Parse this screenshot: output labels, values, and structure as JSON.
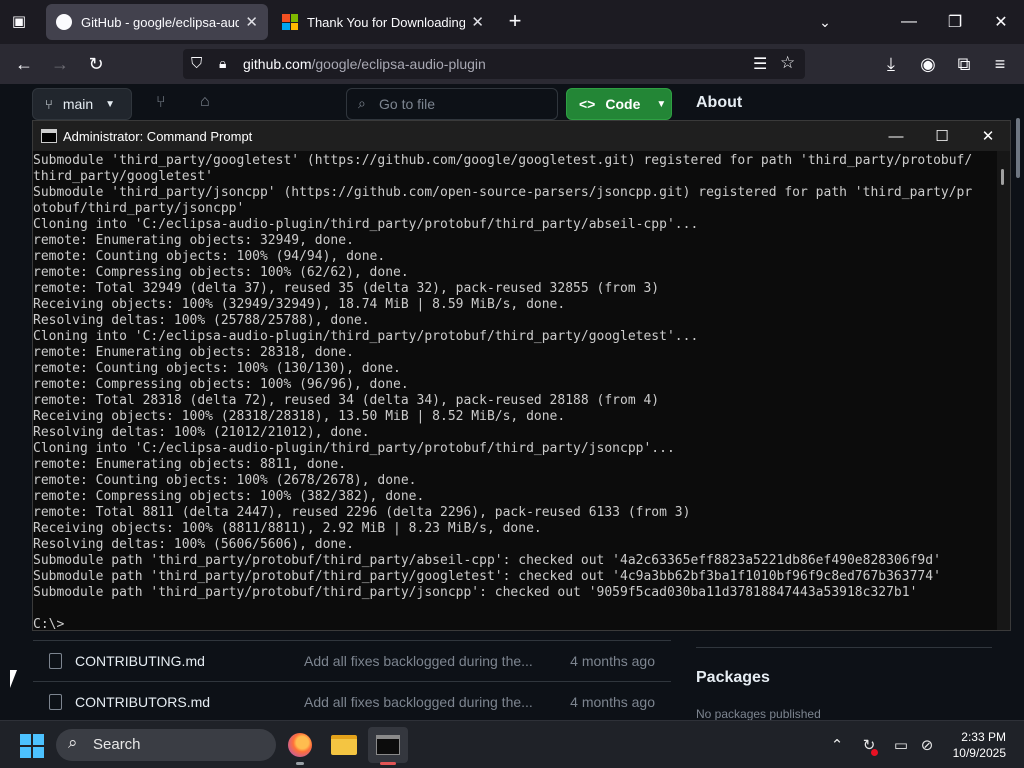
{
  "browser": {
    "tabs": [
      {
        "title": "GitHub - google/eclipsa-audio-",
        "active": true
      },
      {
        "title": "Thank You for Downloading Vis",
        "active": false
      }
    ],
    "new_tab_symbol": "+",
    "url_host": "github.com",
    "url_path": "/google/eclipsa-audio-plugin"
  },
  "github": {
    "branch": "main",
    "go_to_file_placeholder": "Go to file",
    "code_button": "Code",
    "about_heading": "About",
    "files": [
      {
        "name": "CONTRIBUTING.md",
        "message": "Add all fixes backlogged during the...",
        "date": "4 months ago"
      },
      {
        "name": "CONTRIBUTORS.md",
        "message": "Add all fixes backlogged during the...",
        "date": "4 months ago"
      }
    ],
    "packages_heading": "Packages",
    "packages_empty": "No packages published"
  },
  "cmd": {
    "title": "Administrator: Command Prompt",
    "lines": [
      "Submodule 'third_party/googletest' (https://github.com/google/googletest.git) registered for path 'third_party/protobuf/",
      "third_party/googletest'",
      "Submodule 'third_party/jsoncpp' (https://github.com/open-source-parsers/jsoncpp.git) registered for path 'third_party/pr",
      "otobuf/third_party/jsoncpp'",
      "Cloning into 'C:/eclipsa-audio-plugin/third_party/protobuf/third_party/abseil-cpp'...",
      "remote: Enumerating objects: 32949, done.",
      "remote: Counting objects: 100% (94/94), done.",
      "remote: Compressing objects: 100% (62/62), done.",
      "remote: Total 32949 (delta 37), reused 35 (delta 32), pack-reused 32855 (from 3)",
      "Receiving objects: 100% (32949/32949), 18.74 MiB | 8.59 MiB/s, done.",
      "Resolving deltas: 100% (25788/25788), done.",
      "Cloning into 'C:/eclipsa-audio-plugin/third_party/protobuf/third_party/googletest'...",
      "remote: Enumerating objects: 28318, done.",
      "remote: Counting objects: 100% (130/130), done.",
      "remote: Compressing objects: 100% (96/96), done.",
      "remote: Total 28318 (delta 72), reused 34 (delta 34), pack-reused 28188 (from 4)",
      "Receiving objects: 100% (28318/28318), 13.50 MiB | 8.52 MiB/s, done.",
      "Resolving deltas: 100% (21012/21012), done.",
      "Cloning into 'C:/eclipsa-audio-plugin/third_party/protobuf/third_party/jsoncpp'...",
      "remote: Enumerating objects: 8811, done.",
      "remote: Counting objects: 100% (2678/2678), done.",
      "remote: Compressing objects: 100% (382/382), done.",
      "remote: Total 8811 (delta 2447), reused 2296 (delta 2296), pack-reused 6133 (from 3)",
      "Receiving objects: 100% (8811/8811), 2.92 MiB | 8.23 MiB/s, done.",
      "Resolving deltas: 100% (5606/5606), done.",
      "Submodule path 'third_party/protobuf/third_party/abseil-cpp': checked out '4a2c63365eff8823a5221db86ef490e828306f9d'",
      "Submodule path 'third_party/protobuf/third_party/googletest': checked out '4c9a3bb62bf3ba1f1010bf96f9c8ed767b363774'",
      "Submodule path 'third_party/protobuf/third_party/jsoncpp': checked out '9059f5cad030ba11d37818847443a53918c327b1'",
      "",
      "C:\\>"
    ]
  },
  "taskbar": {
    "search_label": "Search",
    "time": "2:33 PM",
    "date": "10/9/2025"
  },
  "colors": {
    "github_green": "#238636",
    "cmd_text": "#cccccc"
  }
}
